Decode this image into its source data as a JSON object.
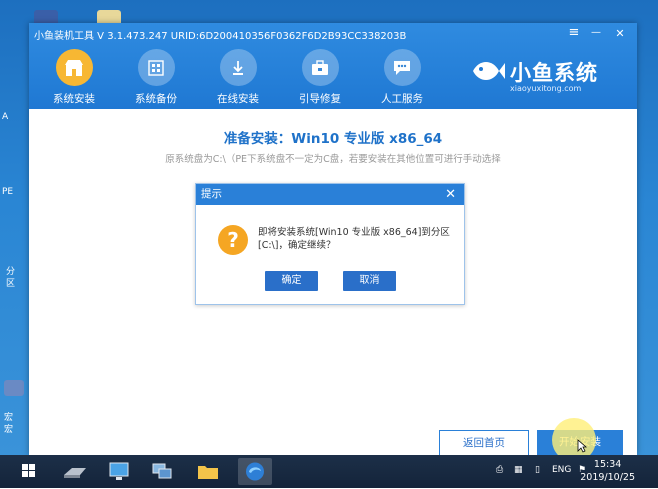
{
  "window": {
    "title": "小鱼装机工具 V 3.1.473.247 URID:6D200410356F0362F6D2B93CC338203B",
    "controls": {
      "menu": "≡",
      "minimize": "—",
      "close": "✕"
    }
  },
  "nav": {
    "items": [
      {
        "label": "系统安装",
        "icon": "store-icon",
        "active": true
      },
      {
        "label": "系统备份",
        "icon": "window-icon",
        "active": false
      },
      {
        "label": "在线安装",
        "icon": "download-icon",
        "active": false
      },
      {
        "label": "引导修复",
        "icon": "toolbox-icon",
        "active": false
      },
      {
        "label": "人工服务",
        "icon": "chat-icon",
        "active": false
      }
    ]
  },
  "logo": {
    "name": "小鱼系统",
    "url": "xiaoyuxitong.com"
  },
  "content": {
    "title": "准备安装：Win10 专业版 x86_64",
    "subtitle": "原系统盘为C:\\（PE下系统盘不一定为C盘，若要安装在其他位置可进行手动选择"
  },
  "dialog": {
    "title": "提示",
    "close": "✕",
    "message": "即将安装系统[Win10 专业版 x86_64]到分区[C:\\]，确定继续？",
    "confirm": "确定",
    "cancel": "取消"
  },
  "footer": {
    "back": "返回首页",
    "start": "开始安装"
  },
  "desktop": {
    "labels": [
      "A",
      "PE",
      "分",
      "区",
      "宏",
      "宏"
    ]
  },
  "taskbar": {
    "lang": "ENG",
    "time": "15:34",
    "date": "2019/10/25"
  },
  "colors": {
    "brand": "#1f78d3",
    "active_nav": "#f7b733",
    "button": "#2a6fc9"
  }
}
